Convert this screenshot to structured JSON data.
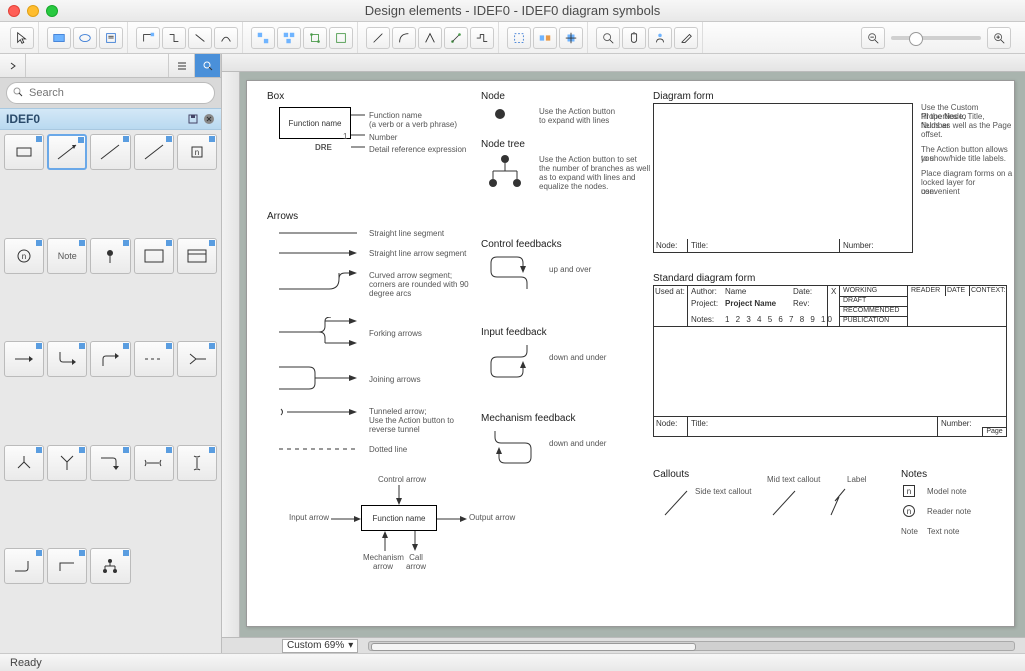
{
  "window": {
    "title": "Design elements - IDEF0 - IDEF0 diagram symbols"
  },
  "sidebar": {
    "search_placeholder": "Search",
    "library_name": "IDEF0",
    "shapes": [
      {
        "name": "activity-box"
      },
      {
        "name": "line-nw-se"
      },
      {
        "name": "line-diag"
      },
      {
        "name": "line-diag2"
      },
      {
        "name": "label-n"
      },
      {
        "name": "circle-n"
      },
      {
        "name": "note-label",
        "text": "Note"
      },
      {
        "name": "dot-arrow"
      },
      {
        "name": "box-plain"
      },
      {
        "name": "box-header"
      },
      {
        "name": "arrow-right"
      },
      {
        "name": "corner-down-right"
      },
      {
        "name": "corner-up-right"
      },
      {
        "name": "dashed-line"
      },
      {
        "name": "fork-left"
      },
      {
        "name": "fork-down"
      },
      {
        "name": "join-down"
      },
      {
        "name": "corner-right-down"
      },
      {
        "name": "tunnel-right"
      },
      {
        "name": "tunnel-down"
      },
      {
        "name": "corner-up"
      },
      {
        "name": "angle"
      },
      {
        "name": "node-tree"
      }
    ]
  },
  "canvas": {
    "zoom_label": "Custom 69%",
    "box": {
      "heading": "Box",
      "function_name": "Function name",
      "number": "1",
      "dre": "DRE",
      "lbl_fn": "Function name",
      "lbl_fn_sub": "(a verb or a verb phrase)",
      "lbl_number": "Number",
      "lbl_dre": "Detail reference expression"
    },
    "arrows": {
      "heading": "Arrows",
      "straight": "Straight line segment",
      "straight_arrow": "Straight line arrow segment",
      "curved": "Curved arrow segment;",
      "curved2": "corners are rounded with 90",
      "curved3": "degree arcs",
      "forking": "Forking arrows",
      "joining": "Joining arrows",
      "tunneled": "Tunneled arrow;",
      "tunneled2": "Use the Action button to",
      "tunneled3": "reverse tunnel",
      "dotted": "Dotted line"
    },
    "activity": {
      "function_name": "Function name",
      "control": "Control arrow",
      "input": "Input arrow",
      "output": "Output arrow",
      "mechanism": "Mechanism",
      "mechanism2": "arrow",
      "call": "Call",
      "call2": "arrow"
    },
    "node": {
      "heading": "Node",
      "desc1": "Use the Action button",
      "desc2": "to expand with lines"
    },
    "nodetree": {
      "heading": "Node tree",
      "desc1": "Use the Action button to set",
      "desc2": "the number of branches as well",
      "desc3": "as to expand with lines and",
      "desc4": "equalize the nodes."
    },
    "feedbacks": {
      "control_h": "Control feedbacks",
      "control_d": "up and over",
      "input_h": "Input feedback",
      "input_d": "down and under",
      "mech_h": "Mechanism feedback",
      "mech_d": "down and under"
    },
    "diagform": {
      "heading": "Diagram form",
      "node": "Node:",
      "title": "Title:",
      "number": "Number:",
      "desc1": "Use the Custom Properties to",
      "desc2": "fill the Node, Title, Number",
      "desc3": "fields as well as the Page",
      "desc4": "offset.",
      "desc5": "The Action button allows you",
      "desc6": "to show/hide title labels.",
      "desc7": "Place diagram forms on a",
      "desc8": "locked layer for convenient",
      "desc9": "use."
    },
    "stdform": {
      "heading": "Standard diagram form",
      "used_at": "Used at:",
      "author": "Author:",
      "author_v": "Name",
      "date": "Date:",
      "project": "Project:",
      "project_v": "Project Name",
      "rev": "Rev:",
      "notes": "Notes:",
      "notes_v": "1  2  3  4  5  6  7  8  9  10",
      "x": "X",
      "working": "WORKING",
      "reader": "READER",
      "date2": "DATE",
      "context": "CONTEXT:",
      "draft": "DRAFT",
      "recommended": "RECOMMENDED",
      "publication": "PUBLICATION",
      "node": "Node:",
      "title": "Title:",
      "number": "Number:",
      "page": "Page"
    },
    "callouts": {
      "heading": "Callouts",
      "side": "Side text callout",
      "mid": "Mid text callout",
      "label": "Label"
    },
    "notes": {
      "heading": "Notes",
      "model": "Model note",
      "reader": "Reader note",
      "text_sym": "Note",
      "text": "Text note",
      "n": "n",
      "nn": "n"
    }
  },
  "status": {
    "text": "Ready"
  }
}
